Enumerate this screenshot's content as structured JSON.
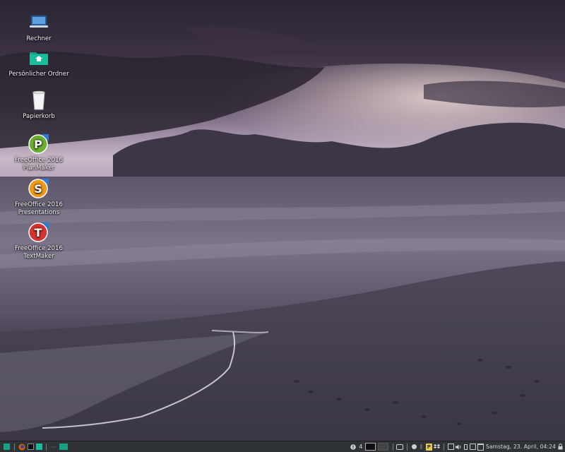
{
  "desktop": {
    "icons": [
      {
        "name": "rechner",
        "label": "Rechner",
        "icon": "laptop-icon"
      },
      {
        "name": "home-folder",
        "label": "Persönlicher Ordner",
        "icon": "home-folder-icon"
      },
      {
        "name": "trash",
        "label": "Papierkorb",
        "icon": "trash-icon"
      },
      {
        "name": "planmaker",
        "label": "FreeOffice 2016\nPlanMaker",
        "icon": "planmaker-icon",
        "letter": "P",
        "color": "#6cae2f"
      },
      {
        "name": "presentations",
        "label": "FreeOffice 2016\nPresentations",
        "icon": "presentations-icon",
        "letter": "S",
        "color": "#f09a1a"
      },
      {
        "name": "textmaker",
        "label": "FreeOffice 2016\nTextMaker",
        "icon": "textmaker-icon",
        "letter": "T",
        "color": "#d8322f"
      }
    ]
  },
  "taskbar": {
    "workspace_count": "4",
    "clock": "Samstag, 23. April, 04:24",
    "colors": {
      "accent": "#16a085",
      "bar": "#2f3236"
    }
  }
}
